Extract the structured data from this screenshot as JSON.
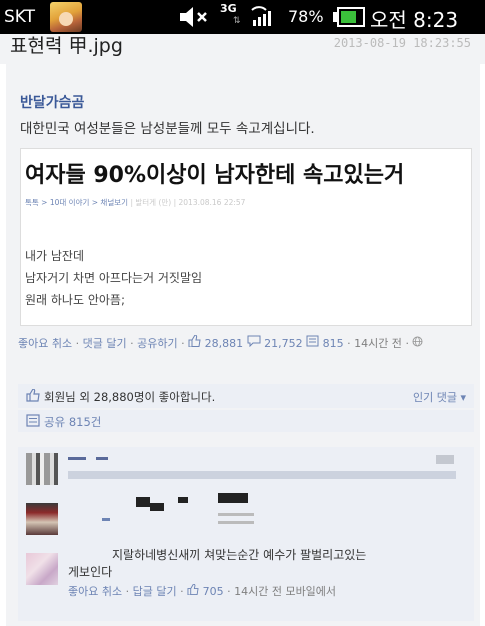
{
  "status_bar": {
    "carrier": "SKT",
    "network": "3G",
    "battery_percent_label": "78%",
    "battery_level": 0.78,
    "clock": "오전 8:23"
  },
  "file": {
    "name": "표현력 甲.jpg",
    "timestamp": "2013-08-19 18:23:55"
  },
  "post": {
    "author": "반달가슴곰",
    "text": "대한민국 여성분들은 남성분들께 모두 속고계십니다.",
    "embed": {
      "title": "여자들 90%이상이 남자한테 속고있는거",
      "meta_breadcrumb": "톡톡 > 10대 이야기 > 채널보기",
      "meta_author": "발터게 (만)",
      "meta_date": "2013.08.16 22:57",
      "body_lines": [
        "내가 남잔데",
        "남자거기 차면 아프다는거 거짓말임",
        "원래 하나도 안아픔;"
      ]
    },
    "actions": {
      "like_link": "좋아요 취소",
      "comment_link": "댓글 달기",
      "share_link": "공유하기",
      "like_count": "28,881",
      "comment_count": "21,752",
      "share_count": "815",
      "time_label": "14시간 전"
    },
    "likes_summary": "회원님 외 28,880명이 좋아합니다.",
    "popular_comments_label": "인기 댓글 ▾",
    "share_summary": "공유 815건"
  },
  "comments": {
    "third": {
      "text_line1": "지랄하네병신새끼 쳐맞는순간 예수가 팔벌리고있는",
      "text_line2": "게보인다",
      "like_link": "좋아요 취소",
      "reply_link": "답글 달기",
      "like_count": "705",
      "time_label": "14시간 전 모바일에서"
    }
  },
  "icons": {
    "mute": "speaker-muted-icon",
    "signal": "signal-bars-icon",
    "battery": "battery-icon",
    "thumb": "thumbs-up-icon",
    "comment": "comment-bubble-icon",
    "share": "share-icon",
    "globe": "globe-icon"
  },
  "colors": {
    "link": "#6d84b4",
    "author": "#3b5998",
    "battery_fill": "#3bbf3b"
  }
}
